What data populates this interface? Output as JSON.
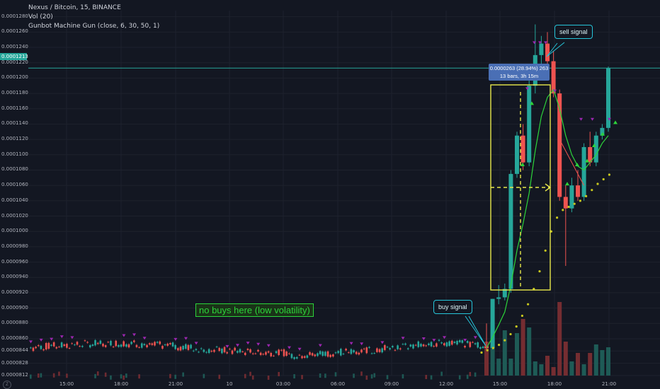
{
  "legend": {
    "symbol_line": "Nexus / Bitcoin, 15, BINANCE",
    "volume_line": "Vol (20)",
    "indicator_line": "Gunbot Machine Gun (close, 6, 30, 50, 1)"
  },
  "annotations": {
    "sell_signal": "sell signal",
    "buy_signal": "buy signal",
    "low_volatility_note": "no buys here (low volatility)",
    "measure_line1": "0.0000263 (28.94%) 263",
    "measure_line2": "13 bars, 3h 15m"
  },
  "current_price_label": "0.0001213",
  "colors": {
    "background": "#131722",
    "up": "#26a69a",
    "down": "#ef5350",
    "ma_line": "#2cd43a",
    "dots": "#c8c81e",
    "markers": "#9c27b0",
    "box": "#e8e84a",
    "price_line": "#26a69a",
    "callout": "#26c6da"
  },
  "chart_data": {
    "type": "candlestick",
    "title": "Nexus / Bitcoin, 15, BINANCE",
    "y_axis": {
      "min": 8.12e-05,
      "max": 0.0001288,
      "ticks": [
        "0.0001280",
        "0.0001260",
        "0.0001240",
        "0.0001220",
        "0.0001200",
        "0.0001180",
        "0.0001160",
        "0.0001140",
        "0.0001120",
        "0.0001100",
        "0.0001080",
        "0.0001060",
        "0.0001040",
        "0.0001020",
        "0.0001000",
        "0.0000980",
        "0.0000960",
        "0.0000940",
        "0.0000920",
        "0.0000900",
        "0.0000880",
        "0.0000860",
        "0.0000844",
        "0.0000828",
        "0.0000812"
      ]
    },
    "x_axis": {
      "ticks": [
        "15:00",
        "18:00",
        "21:00",
        "10",
        "03:00",
        "06:00",
        "09:00",
        "12:00",
        "15:00",
        "18:00",
        "21:00"
      ]
    },
    "candles_tail": [
      {
        "o": 8.5e-05,
        "h": 8.8e-05,
        "l": 8.45e-05,
        "c": 8.48e-05
      },
      {
        "o": 8.48e-05,
        "h": 9.12e-05,
        "l": 8.46e-05,
        "c": 9.12e-05
      },
      {
        "o": 9.12e-05,
        "h": 9.3e-05,
        "l": 9.05e-05,
        "c": 9.14e-05
      },
      {
        "o": 9.14e-05,
        "h": 9.32e-05,
        "l": 9.1e-05,
        "c": 9.25e-05
      },
      {
        "o": 9.25e-05,
        "h": 0.000108,
        "l": 9.2e-05,
        "c": 0.0001075
      },
      {
        "o": 0.0001075,
        "h": 0.000113,
        "l": 0.000107,
        "c": 0.0001125
      },
      {
        "o": 0.0001125,
        "h": 0.000114,
        "l": 0.000108,
        "c": 0.000109
      },
      {
        "o": 0.000109,
        "h": 0.00012,
        "l": 0.0001085,
        "c": 0.000119
      },
      {
        "o": 0.000119,
        "h": 0.000127,
        "l": 0.000118,
        "c": 0.000123
      },
      {
        "o": 0.000123,
        "h": 0.0001255,
        "l": 0.00012,
        "c": 0.0001245
      },
      {
        "o": 0.0001245,
        "h": 0.000126,
        "l": 0.0001215,
        "c": 0.0001222
      },
      {
        "o": 0.0001222,
        "h": 0.0001235,
        "l": 0.0001175,
        "c": 0.000118
      },
      {
        "o": 0.000118,
        "h": 0.0001185,
        "l": 0.000104,
        "c": 0.0001045
      },
      {
        "o": 0.0001045,
        "h": 0.000106,
        "l": 9.55e-05,
        "c": 0.000103
      },
      {
        "o": 0.000103,
        "h": 0.000107,
        "l": 0.0001025,
        "c": 0.000106
      },
      {
        "o": 0.000106,
        "h": 0.000108,
        "l": 0.000104,
        "c": 0.0001045
      },
      {
        "o": 0.0001045,
        "h": 0.0001115,
        "l": 0.000104,
        "c": 0.000111
      },
      {
        "o": 0.000111,
        "h": 0.000113,
        "l": 0.0001085,
        "c": 0.000109
      },
      {
        "o": 0.000109,
        "h": 0.000113,
        "l": 0.0001085,
        "c": 0.0001125
      },
      {
        "o": 0.0001125,
        "h": 0.000114,
        "l": 0.000112,
        "c": 0.0001135
      },
      {
        "o": 0.0001135,
        "h": 0.0001215,
        "l": 0.000113,
        "c": 0.0001213
      }
    ]
  }
}
